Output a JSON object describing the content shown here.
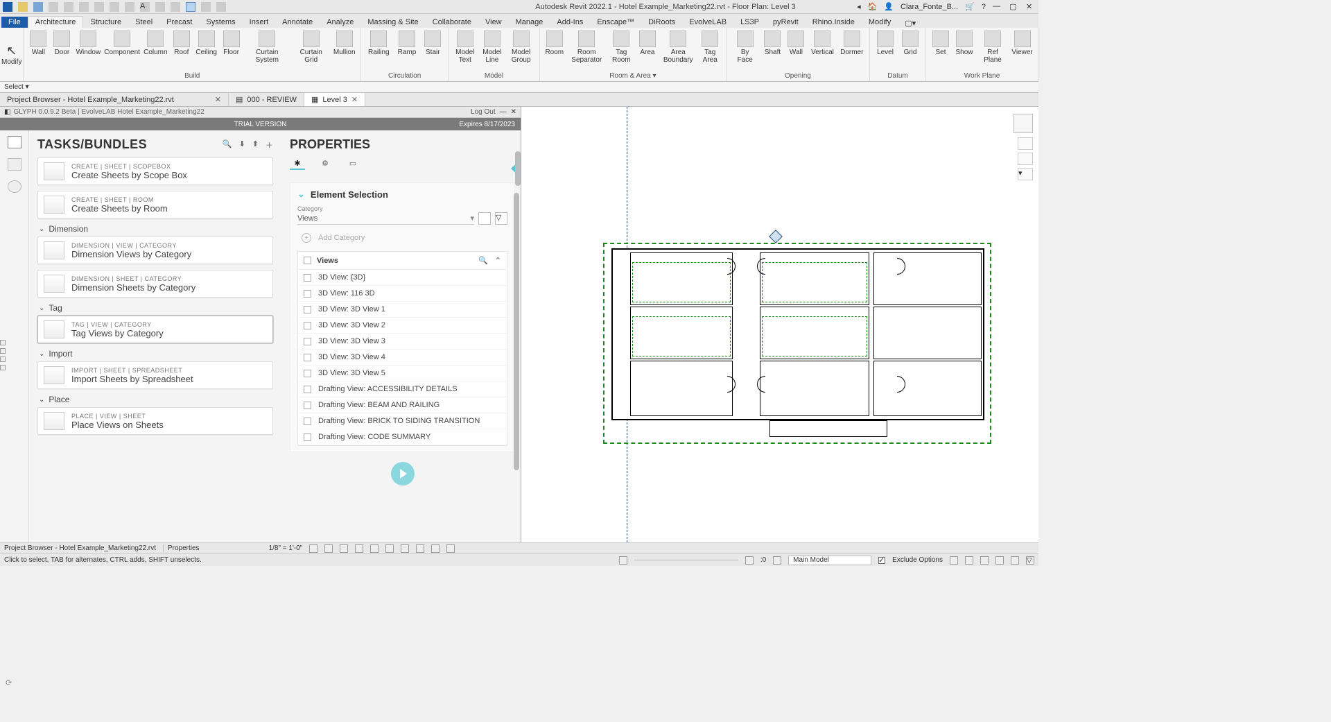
{
  "titlebar": {
    "title": "Autodesk Revit 2022.1 - Hotel Example_Marketing22.rvt - Floor Plan: Level 3",
    "user": "Clara_Fonte_B..."
  },
  "ribbontabs": {
    "file": "File",
    "tabs": [
      "Architecture",
      "Structure",
      "Steel",
      "Precast",
      "Systems",
      "Insert",
      "Annotate",
      "Analyze",
      "Massing & Site",
      "Collaborate",
      "View",
      "Manage",
      "Add-Ins",
      "Enscape™",
      "DiRoots",
      "EvolveLAB",
      "LS3P",
      "pyRevit",
      "Rhino.Inside",
      "Modify"
    ],
    "active": "Architecture"
  },
  "ribbon": {
    "modify": "Modify",
    "select": "Select ▾",
    "groups": [
      {
        "label": "Build",
        "items": [
          "Wall",
          "Door",
          "Window",
          "Component",
          "Column",
          "Roof",
          "Ceiling",
          "Floor",
          "Curtain System",
          "Curtain Grid",
          "Mullion"
        ]
      },
      {
        "label": "Circulation",
        "items": [
          "Railing",
          "Ramp",
          "Stair"
        ]
      },
      {
        "label": "Model",
        "items": [
          "Model Text",
          "Model Line",
          "Model Group"
        ]
      },
      {
        "label": "Room & Area ▾",
        "items": [
          "Room",
          "Room Separator",
          "Tag Room",
          "Area",
          "Area Boundary",
          "Tag Area"
        ]
      },
      {
        "label": "Opening",
        "items": [
          "By Face",
          "Shaft",
          "Wall",
          "Vertical",
          "Dormer"
        ]
      },
      {
        "label": "Datum",
        "items": [
          "Level",
          "Grid"
        ]
      },
      {
        "label": "Work Plane",
        "items": [
          "Set",
          "Show",
          "Ref Plane",
          "Viewer"
        ]
      }
    ]
  },
  "doctabs": {
    "tabs": [
      {
        "label": "Project Browser - Hotel Example_Marketing22.rvt",
        "closable": true,
        "active": false
      },
      {
        "label": "000 - REVIEW",
        "closable": false,
        "active": false,
        "icon": true
      },
      {
        "label": "Level 3",
        "closable": true,
        "active": true,
        "icon": true
      }
    ]
  },
  "plugin": {
    "header_left": "GLYPH 0.0.9.2 Beta  | EvolveLAB  Hotel Example_Marketing22",
    "logout": "Log Out",
    "trial": "TRIAL VERSION",
    "expires": "Expires 8/17/2023"
  },
  "tasks": {
    "title": "TASKS/BUNDLES",
    "cards": [
      {
        "bc": "CREATE  |  SHEET  |  SCOPEBOX",
        "title": "Create Sheets by Scope Box"
      },
      {
        "bc": "CREATE  |  SHEET  |  ROOM",
        "title": "Create Sheets by Room"
      }
    ],
    "sections": [
      {
        "name": "Dimension",
        "cards": [
          {
            "bc": "DIMENSION  |  VIEW  |  CATEGORY",
            "title": "Dimension Views by Category"
          },
          {
            "bc": "DIMENSION  |  SHEET  |  CATEGORY",
            "title": "Dimension Sheets by Category"
          }
        ]
      },
      {
        "name": "Tag",
        "cards": [
          {
            "bc": "TAG  |  VIEW  |  CATEGORY",
            "title": "Tag Views by Category",
            "selected": true
          }
        ]
      },
      {
        "name": "Import",
        "cards": [
          {
            "bc": "IMPORT  |  SHEET  |  SPREADSHEET",
            "title": "Import Sheets by Spreadsheet"
          }
        ]
      },
      {
        "name": "Place",
        "cards": [
          {
            "bc": "PLACE  |  VIEW  |  SHEET",
            "title": "Place Views on Sheets"
          }
        ]
      }
    ]
  },
  "props": {
    "title": "PROPERTIES",
    "section_title": "Element Selection",
    "cat_label": "Category",
    "cat_value": "Views",
    "add_category": "Add Category",
    "views_header": "Views",
    "views": [
      "3D View: {3D}",
      "3D View: 116 3D",
      "3D View: 3D View 1",
      "3D View: 3D View 2",
      "3D View: 3D View 3",
      "3D View: 3D View 4",
      "3D View: 3D View 5",
      "Drafting View: ACCESSIBILITY DETAILS",
      "Drafting View: BEAM AND RAILING",
      "Drafting View: BRICK TO SIDING TRANSITION",
      "Drafting View: CODE SUMMARY"
    ]
  },
  "status1": {
    "left": "Project Browser - Hotel Example_Marketing22.rvt",
    "props": "Properties",
    "scale": "1/8\" = 1'-0\""
  },
  "status2": {
    "hint": "Click to select, TAB for alternates, CTRL adds, SHIFT unselects.",
    "zero": ":0",
    "model": "Main Model",
    "exclude": "Exclude Options"
  }
}
